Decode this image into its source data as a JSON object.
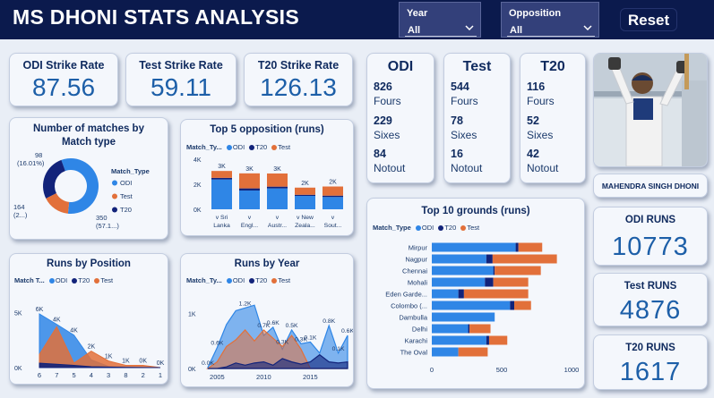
{
  "header": {
    "title": "MS DHONI STATS ANALYSIS",
    "reset_label": "Reset"
  },
  "filters": [
    {
      "label": "Year",
      "value": "All"
    },
    {
      "label": "Opposition",
      "value": "All"
    }
  ],
  "colors": {
    "odi": "#2f86e6",
    "t20": "#12237a",
    "test": "#e2703a",
    "header_bg": "#0b1a4d"
  },
  "strike_rates": [
    {
      "label": "ODI Strike Rate",
      "value": "87.56"
    },
    {
      "label": "Test Strike Rate",
      "value": "59.11"
    },
    {
      "label": "T20 Strike Rate",
      "value": "126.13"
    }
  ],
  "formats": [
    {
      "title": "ODI",
      "fours": "826",
      "fours_label": "Fours",
      "sixes": "229",
      "sixes_label": "Sixes",
      "notout": "84",
      "notout_label": "Notout"
    },
    {
      "title": "Test",
      "fours": "544",
      "fours_label": "Fours",
      "sixes": "78",
      "sixes_label": "Sixes",
      "notout": "16",
      "notout_label": "Notout"
    },
    {
      "title": "T20",
      "fours": "116",
      "fours_label": "Fours",
      "sixes": "52",
      "sixes_label": "Sixes",
      "notout": "42",
      "notout_label": "Notout"
    }
  ],
  "player": {
    "name": "MAHENDRA SINGH DHONI"
  },
  "runs": [
    {
      "label": "ODI RUNS",
      "value": "10773"
    },
    {
      "label": "Test RUNS",
      "value": "4876"
    },
    {
      "label": "T20 RUNS",
      "value": "1617"
    }
  ],
  "chart_data": [
    {
      "type": "pie",
      "title": "Number of matches by Match type",
      "legend_title": "Match_Type",
      "legend_position": "right",
      "slices": [
        {
          "name": "ODI",
          "value": 350,
          "label": "350 (57.1...)"
        },
        {
          "name": "Test",
          "value": 98,
          "label": "98 (16.01%)"
        },
        {
          "name": "T20",
          "value": 164,
          "label": "164 (2...)"
        }
      ]
    },
    {
      "type": "bar",
      "stacked": true,
      "title": "Top 5 opposition (runs)",
      "legend_title": "Match_Ty...",
      "categories": [
        "v Sri Lanka",
        "v Engl...",
        "v Austr...",
        "v New Zeala...",
        "v Sout..."
      ],
      "category_lines": [
        [
          "v Sri",
          "Lanka"
        ],
        [
          "v",
          "Engl..."
        ],
        [
          "v",
          "Austr..."
        ],
        [
          "v New",
          "Zeala..."
        ],
        [
          "v",
          "Sout..."
        ]
      ],
      "series": [
        {
          "name": "ODI",
          "values": [
            2380,
            1500,
            1670,
            1070,
            980
          ]
        },
        {
          "name": "T20",
          "values": [
            130,
            170,
            140,
            90,
            110
          ]
        },
        {
          "name": "Test",
          "values": [
            550,
            1200,
            1050,
            570,
            730
          ]
        }
      ],
      "data_labels": [
        "3K",
        "3K",
        "3K",
        "2K",
        "2K"
      ],
      "y_ticks": [
        "4K",
        "2K",
        "0K"
      ],
      "ylim": [
        0,
        4000
      ]
    },
    {
      "type": "area",
      "title": "Runs by Position",
      "legend_title": "Match T...",
      "categories": [
        "6",
        "7",
        "5",
        "4",
        "3",
        "8",
        "2",
        "1"
      ],
      "series": [
        {
          "name": "ODI",
          "values": [
            4870,
            3930,
            2950,
            700,
            100,
            60,
            0,
            0
          ]
        },
        {
          "name": "Test",
          "values": [
            1200,
            3700,
            400,
            1500,
            600,
            200,
            200,
            0
          ]
        },
        {
          "name": "T20",
          "values": [
            400,
            300,
            200,
            80,
            50,
            20,
            10,
            0
          ]
        }
      ],
      "data_labels": [
        "6K",
        "4K",
        "4K",
        "2K",
        "1K",
        "1K",
        "0K",
        "0K"
      ],
      "y_ticks": [
        "5K",
        "0K"
      ],
      "ylim": [
        0,
        6500
      ]
    },
    {
      "type": "area",
      "title": "Runs by Year",
      "legend_title": "Match_Ty...",
      "x": [
        2004,
        2005,
        2006,
        2007,
        2008,
        2009,
        2010,
        2011,
        2012,
        2013,
        2014,
        2015,
        2016,
        2017,
        2018,
        2019
      ],
      "series": [
        {
          "name": "ODI",
          "values": [
            20,
            380,
            800,
            1050,
            1100,
            1150,
            600,
            750,
            350,
            700,
            450,
            480,
            280,
            780,
            280,
            600
          ]
        },
        {
          "name": "Test",
          "values": [
            0,
            120,
            400,
            520,
            700,
            500,
            700,
            550,
            400,
            600,
            350,
            0,
            0,
            0,
            0,
            0
          ]
        },
        {
          "name": "T20",
          "values": [
            0,
            0,
            30,
            100,
            60,
            100,
            120,
            60,
            180,
            120,
            80,
            120,
            250,
            120,
            100,
            120
          ]
        }
      ],
      "data_labels": [
        {
          "x": 2004,
          "text": "0.0K"
        },
        {
          "x": 2005,
          "text": "0.6K"
        },
        {
          "x": 2008,
          "text": "1.2K"
        },
        {
          "x": 2010,
          "text": "0.7K"
        },
        {
          "x": 2011,
          "text": "0.6K"
        },
        {
          "x": 2012,
          "text": "0.3K"
        },
        {
          "x": 2013,
          "text": "0.5K"
        },
        {
          "x": 2014,
          "text": "0.3K"
        },
        {
          "x": 2015,
          "text": "0.1K"
        },
        {
          "x": 2017,
          "text": "0.8K"
        },
        {
          "x": 2018,
          "text": "0.1K"
        },
        {
          "x": 2019,
          "text": "0.6K"
        }
      ],
      "x_ticks": [
        "2005",
        "2010",
        "2015"
      ],
      "y_ticks": [
        "1K",
        "0K"
      ],
      "ylim": [
        0,
        1300
      ]
    },
    {
      "type": "bar",
      "orientation": "horizontal",
      "stacked": true,
      "title": "Top 10 grounds (runs)",
      "legend_title": "Match_Type",
      "categories": [
        "Mirpur",
        "Nagpur",
        "Chennai",
        "Mohali",
        "Eden Garde...",
        "Colombo (...",
        "Dambulla",
        "Delhi",
        "Karachi",
        "The Oval"
      ],
      "series": [
        {
          "name": "ODI",
          "values": [
            600,
            390,
            440,
            380,
            190,
            560,
            450,
            260,
            390,
            190
          ]
        },
        {
          "name": "T20",
          "values": [
            20,
            45,
            10,
            60,
            40,
            30,
            0,
            10,
            20,
            0
          ]
        },
        {
          "name": "Test",
          "values": [
            170,
            460,
            330,
            250,
            460,
            120,
            0,
            150,
            130,
            210
          ]
        }
      ],
      "x_ticks": [
        "0",
        "500",
        "1000"
      ],
      "xlim": [
        0,
        1000
      ]
    }
  ]
}
